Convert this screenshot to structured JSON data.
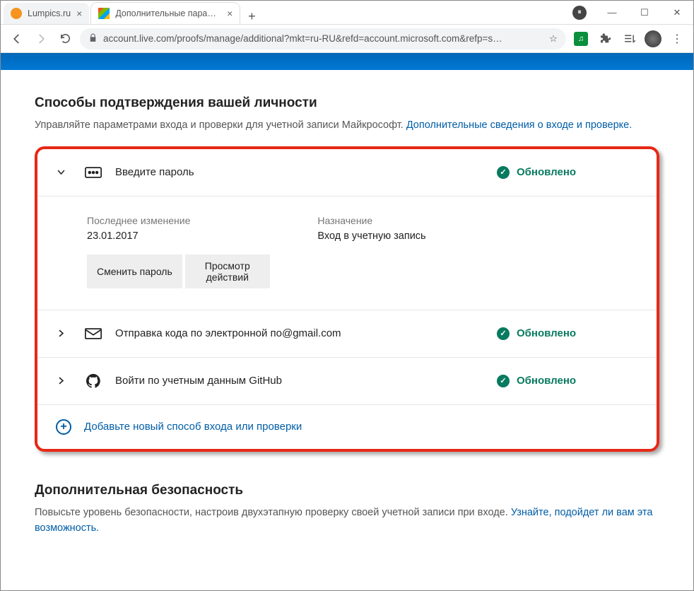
{
  "window": {
    "tabs": [
      {
        "title": "Lumpics.ru"
      },
      {
        "title": "Дополнительные параметры бе"
      }
    ],
    "url_display": "account.live.com/proofs/manage/additional?mkt=ru-RU&refd=account.microsoft.com&refp=s…"
  },
  "section1": {
    "title": "Способы подтверждения вашей личности",
    "subtitle_pre": "Управляйте параметрами входа и проверки для учетной записи Майкрософт. ",
    "subtitle_link": "Дополнительные сведения о входе и проверке.",
    "items": [
      {
        "label": "Введите пароль",
        "status": "Обновлено",
        "expanded": {
          "last_change_label": "Последнее изменение",
          "last_change_value": "23.01.2017",
          "purpose_label": "Назначение",
          "purpose_value": "Вход в учетную запись",
          "btn_change": "Сменить пароль",
          "btn_activity": "Просмотр действий"
        }
      },
      {
        "label": "Отправка кода по электронной по@gmail.com",
        "status": "Обновлено"
      },
      {
        "label": "Войти по учетным данным GitHub",
        "status": "Обновлено"
      }
    ],
    "add_label": "Добавьте новый способ входа или проверки"
  },
  "section2": {
    "title": "Дополнительная безопасность",
    "subtitle_pre": "Повысьте уровень безопасности, настроив двухэтапную проверку своей учетной записи при входе. ",
    "subtitle_link": "Узнайте, подойдет ли вам эта возможность."
  }
}
